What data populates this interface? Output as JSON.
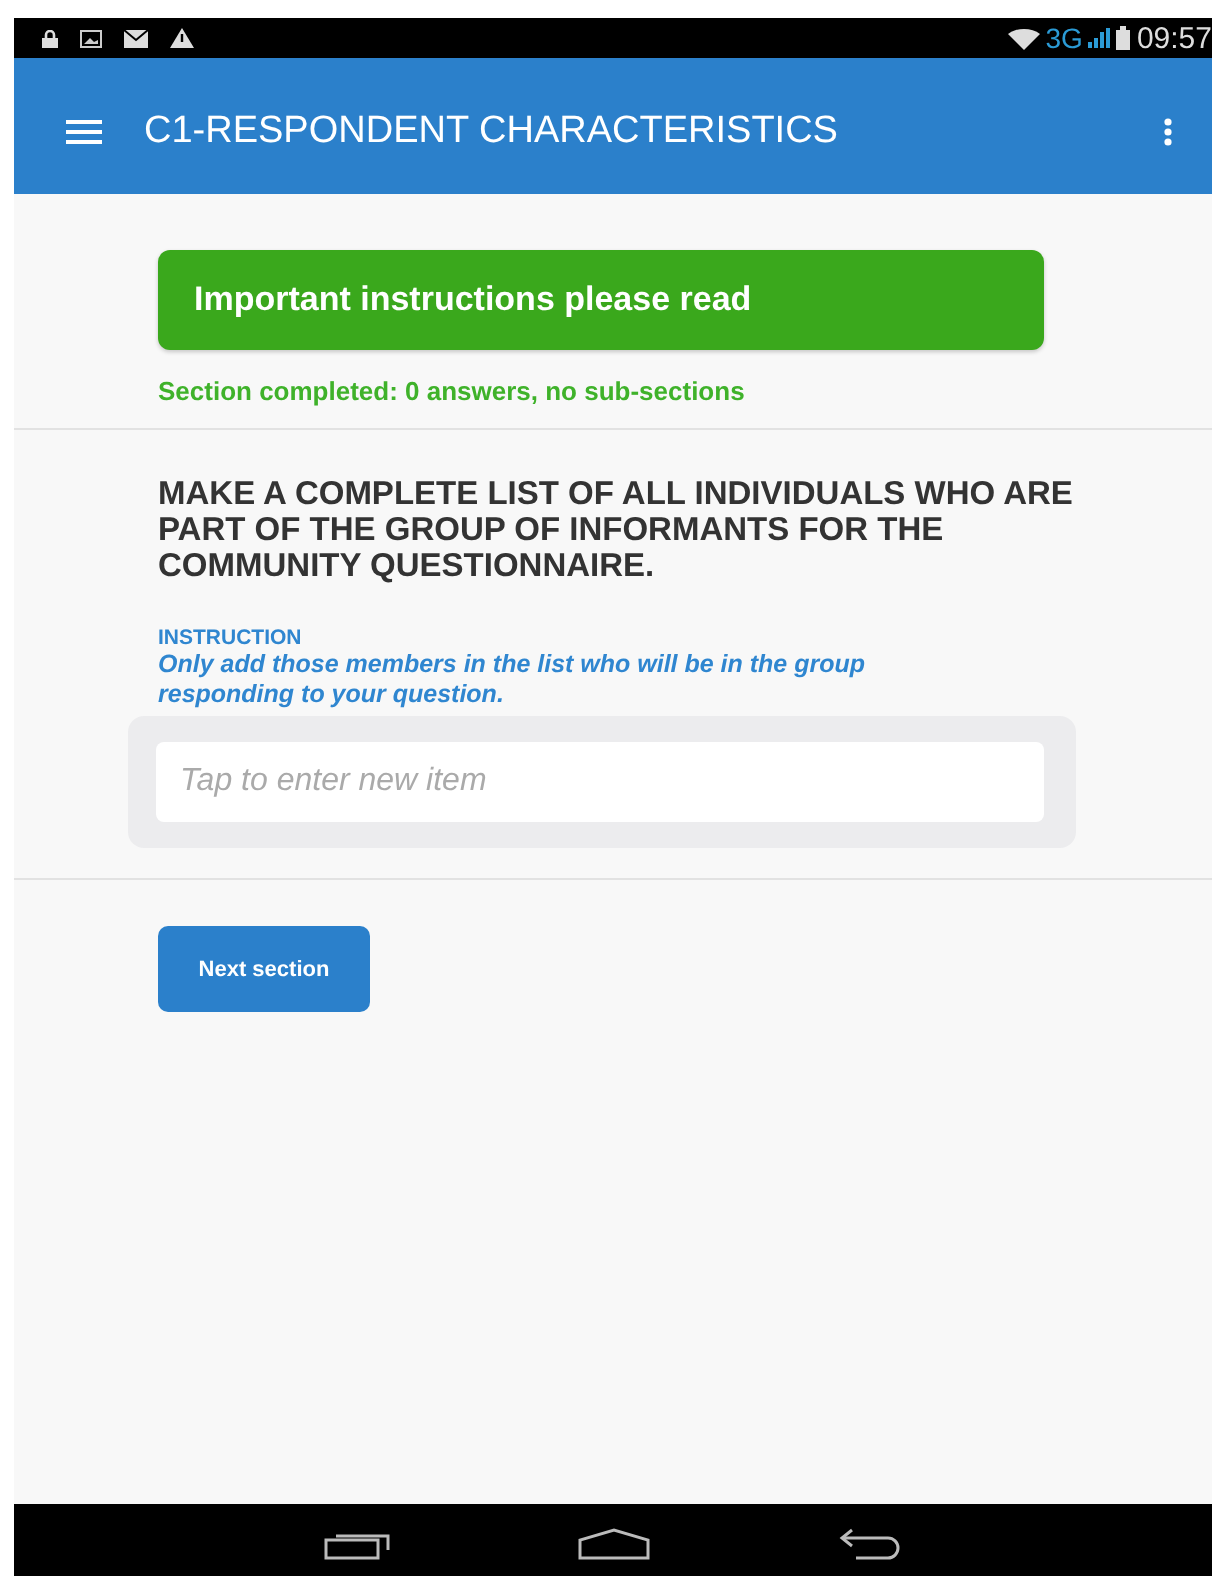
{
  "status_bar": {
    "network": "3G",
    "time": "09:57"
  },
  "app_bar": {
    "title": "C1-RESPONDENT CHARACTERISTICS"
  },
  "banner": {
    "label": "Important instructions please read"
  },
  "section_status": "Section completed: 0 answers, no sub-sections",
  "question": {
    "text": "MAKE A COMPLETE LIST OF ALL INDIVIDUALS WHO ARE PART OF THE GROUP OF INFORMANTS FOR THE COMMUNITY QUESTIONNAIRE.",
    "instruction_label": "INSTRUCTION",
    "instruction": "Only add those members in the list who will be in the group responding to your question.",
    "field": {
      "placeholder": "Tap to enter new item"
    }
  },
  "next_button": "Next section"
}
